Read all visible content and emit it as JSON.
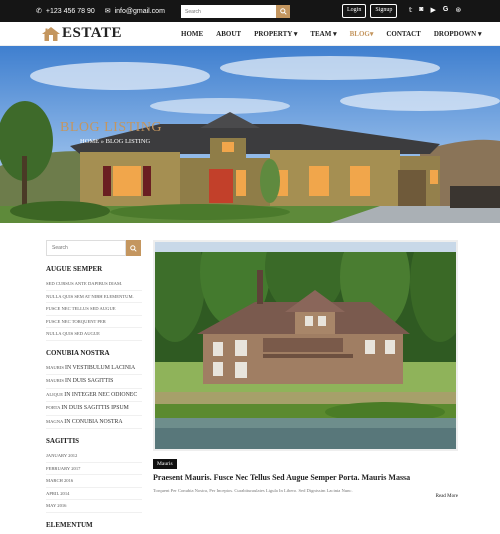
{
  "topbar": {
    "phone": "+123 456 78 90",
    "email": "info@gmail.com",
    "search_placeholder": "Search",
    "login_label": "Login",
    "signup_label": "Signup",
    "social_icons": [
      "twitter-icon",
      "instagram-icon",
      "youtube-icon",
      "google-icon",
      "dribbble-icon"
    ]
  },
  "nav": {
    "logo_text": "ESTATE",
    "items": [
      {
        "label": "HOME"
      },
      {
        "label": "ABOUT"
      },
      {
        "label": "PROPERTY ▾"
      },
      {
        "label": "TEAM ▾"
      },
      {
        "label": "BLOG▾"
      },
      {
        "label": "CONTACT"
      },
      {
        "label": "DROPDOWN ▾"
      }
    ],
    "active_index": 4
  },
  "hero": {
    "title": "BLOG LISTING",
    "breadcrumb": "HOME  »  BLOG LISTING"
  },
  "sidebar": {
    "search_placeholder": "Search",
    "sections": [
      {
        "heading": "AUGUE SEMPER",
        "items": [
          "SED CURSUS ANTE DAPIBUS DIAM.",
          "NULLA QUIS SEM AT NIBH ELEMENTUM.",
          "FUSCE NEC TELLUS SED AUGUE",
          "FUSCE NEC TORQUENT PER",
          "NULLA QUIS SED AUGUE"
        ]
      },
      {
        "heading": "CONUBIA NOSTRA",
        "items": [
          {
            "pre": "MAURIS",
            "rest": "IN VESTIBULUM LACINIA"
          },
          {
            "pre": "MAURIS",
            "rest": "IN DUIS SAGITTIS"
          },
          {
            "pre": "ALIQUE",
            "rest": "IN INTEGER NEC ODIONEC"
          },
          {
            "pre": "PORTA",
            "rest": "IN DUIS SAGITTIS IPSUM"
          },
          {
            "pre": "MAGNA",
            "rest": "IN CONUBIA NOSTRA"
          }
        ]
      },
      {
        "heading": "SAGITTIS",
        "items": [
          "JANUARY 2012",
          "FEBRUARY 2017",
          "MARCH 2016",
          "APRIL 2014",
          "MAY 2016"
        ]
      },
      {
        "heading": "ELEMENTUM",
        "items": []
      }
    ]
  },
  "post": {
    "tag": "Mauris",
    "title": "Praesent Mauris. Fusce Nec Tellus Sed Augue Semper Porta. Mauris Massa",
    "excerpt": "Torquent Per Conubia Nostra, Per Inceptos. Curabituraulates Ligula In Libero. Sed Dignissim Lacinia Nunc.",
    "read_more": "Read More"
  },
  "colors": {
    "accent": "#c4965f",
    "topbar_bg": "#151515"
  }
}
